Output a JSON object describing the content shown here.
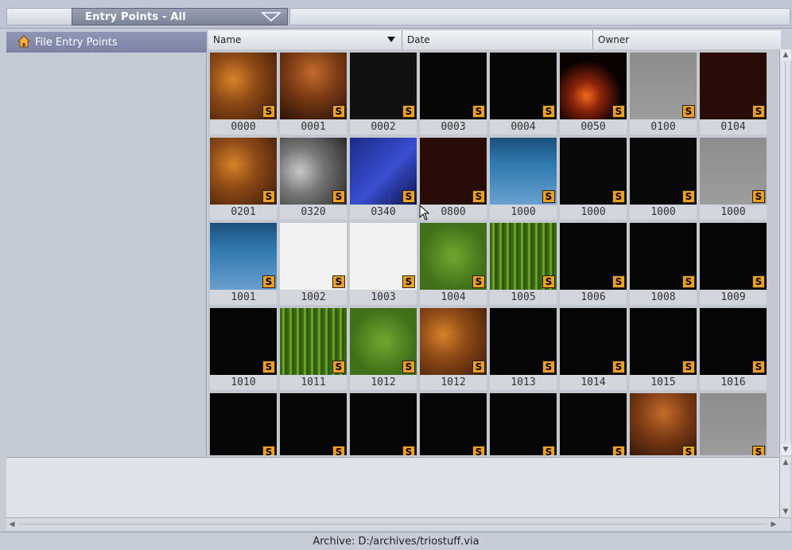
{
  "header": {
    "dropdown_label": "Entry Points - All"
  },
  "sidebar": {
    "items": [
      {
        "label": "File Entry Points",
        "icon": "home-folder-icon"
      }
    ]
  },
  "columns": {
    "name": "Name",
    "date": "Date",
    "owner": "Owner"
  },
  "thumbnails": [
    {
      "label": "0000",
      "art": "art-brown"
    },
    {
      "label": "0001",
      "art": "art-brown2"
    },
    {
      "label": "0002",
      "art": "art-bars"
    },
    {
      "label": "0003",
      "art": "art-black"
    },
    {
      "label": "0004",
      "art": "art-black"
    },
    {
      "label": "0050",
      "art": "art-fire"
    },
    {
      "label": "0100",
      "art": "art-grey"
    },
    {
      "label": "0104",
      "art": "art-dark-red"
    },
    {
      "label": "0201",
      "art": "art-brown"
    },
    {
      "label": "0320",
      "art": "art-vote"
    },
    {
      "label": "0340",
      "art": "art-weather"
    },
    {
      "label": "0800",
      "art": "art-dark-red"
    },
    {
      "label": "1000",
      "art": "art-bluegrid"
    },
    {
      "label": "1000",
      "art": "art-dim"
    },
    {
      "label": "1000",
      "art": "art-dim"
    },
    {
      "label": "1000",
      "art": "art-grey"
    },
    {
      "label": "1001",
      "art": "art-bluegrid"
    },
    {
      "label": "1002",
      "art": "art-white"
    },
    {
      "label": "1003",
      "art": "art-white"
    },
    {
      "label": "1004",
      "art": "art-grass2"
    },
    {
      "label": "1005",
      "art": "art-green-stripes"
    },
    {
      "label": "1006",
      "art": "art-black"
    },
    {
      "label": "1008",
      "art": "art-black"
    },
    {
      "label": "1009",
      "art": "art-black"
    },
    {
      "label": "1010",
      "art": "art-black"
    },
    {
      "label": "1011",
      "art": "art-green-stripes"
    },
    {
      "label": "1012",
      "art": "art-grass2"
    },
    {
      "label": "1012",
      "art": "art-brown"
    },
    {
      "label": "1013",
      "art": "art-black"
    },
    {
      "label": "1014",
      "art": "art-black"
    },
    {
      "label": "1015",
      "art": "art-black"
    },
    {
      "label": "1016",
      "art": "art-black"
    },
    {
      "label": "",
      "art": "art-black"
    },
    {
      "label": "",
      "art": "art-black"
    },
    {
      "label": "",
      "art": "art-black"
    },
    {
      "label": "",
      "art": "art-black"
    },
    {
      "label": "",
      "art": "art-black"
    },
    {
      "label": "",
      "art": "art-black"
    },
    {
      "label": "",
      "art": "art-brown2"
    },
    {
      "label": "",
      "art": "art-grey"
    }
  ],
  "badge_text": "S",
  "status": {
    "archive": "Archive: D:/archives/triostuff.via"
  },
  "colors": {
    "badge": "#f0a020",
    "selected_item": "#7b82a4"
  }
}
